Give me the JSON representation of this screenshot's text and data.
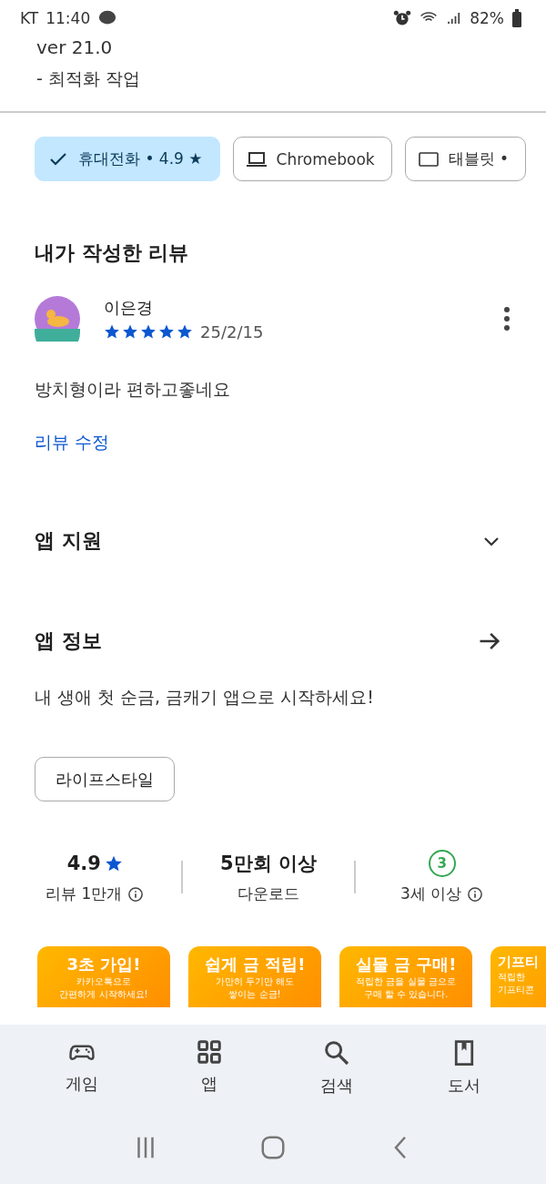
{
  "status_bar": {
    "carrier": "KT",
    "time": "11:40",
    "battery": "82%"
  },
  "whats_new": {
    "version": "ver 21.0",
    "notes": "- 최적화 작업"
  },
  "device_chips": [
    {
      "kind": "phone",
      "label": "휴대전화 • 4.9 ★",
      "selected": true
    },
    {
      "kind": "laptop",
      "label": "Chromebook",
      "selected": false
    },
    {
      "kind": "tablet",
      "label": "태블릿 •",
      "selected": false
    }
  ],
  "my_review": {
    "heading": "내가 작성한 리뷰",
    "author": "이은경",
    "stars": 5,
    "date": "25/2/15",
    "text": "방치형이라 편하고좋네요",
    "edit_link": "리뷰 수정"
  },
  "app_support": {
    "title": "앱 지원",
    "expanded": false
  },
  "app_info": {
    "title": "앱 정보",
    "description": "내 생애 첫 순금, 금캐기 앱으로 시작하세요!",
    "tag": "라이프스타일"
  },
  "stats": [
    {
      "kind": "rating",
      "value": "4.9",
      "label": "리뷰 1만개"
    },
    {
      "kind": "downloads",
      "value": "5만회 이상",
      "label": "다운로드"
    },
    {
      "kind": "age",
      "value": "3",
      "label": "3세 이상"
    }
  ],
  "screenshots": [
    {
      "title": "3초 가입!",
      "lines": [
        "카카오톡으로",
        "간편하게 시작하세요!"
      ]
    },
    {
      "title": "쉽게 금 적립!",
      "lines": [
        "가만히 두기만 해도",
        "쌓이는 순금!"
      ]
    },
    {
      "title": "실물 금 구매!",
      "lines": [
        "적립한 금을 실물 금으로",
        "구매 할 수 있습니다."
      ]
    },
    {
      "title": "기프티",
      "lines": [
        "적립한",
        "기프티콘"
      ]
    }
  ],
  "bottom_nav": [
    {
      "kind": "games",
      "label": "게임"
    },
    {
      "kind": "apps",
      "label": "앱"
    },
    {
      "kind": "search",
      "label": "검색"
    },
    {
      "kind": "books",
      "label": "도서"
    }
  ]
}
